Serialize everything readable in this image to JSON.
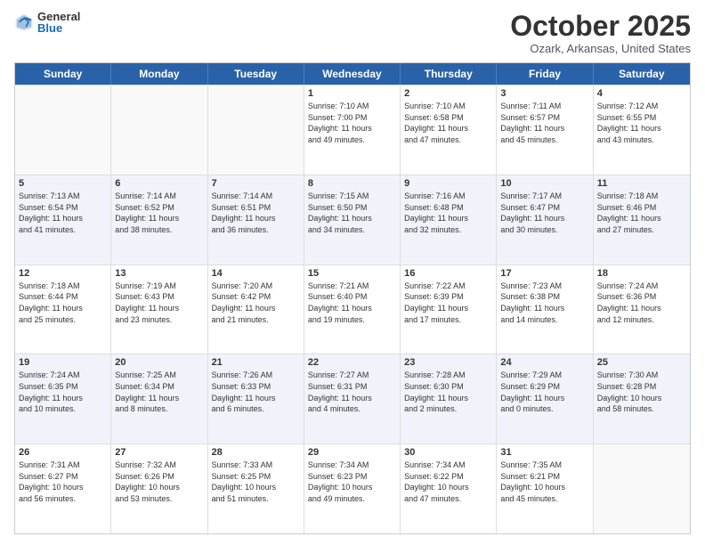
{
  "logo": {
    "general": "General",
    "blue": "Blue"
  },
  "title": "October 2025",
  "subtitle": "Ozark, Arkansas, United States",
  "days_of_week": [
    "Sunday",
    "Monday",
    "Tuesday",
    "Wednesday",
    "Thursday",
    "Friday",
    "Saturday"
  ],
  "rows": [
    [
      {
        "day": "",
        "empty": true
      },
      {
        "day": "",
        "empty": true
      },
      {
        "day": "",
        "empty": true
      },
      {
        "day": "1",
        "lines": [
          "Sunrise: 7:10 AM",
          "Sunset: 7:00 PM",
          "Daylight: 11 hours",
          "and 49 minutes."
        ]
      },
      {
        "day": "2",
        "lines": [
          "Sunrise: 7:10 AM",
          "Sunset: 6:58 PM",
          "Daylight: 11 hours",
          "and 47 minutes."
        ]
      },
      {
        "day": "3",
        "lines": [
          "Sunrise: 7:11 AM",
          "Sunset: 6:57 PM",
          "Daylight: 11 hours",
          "and 45 minutes."
        ]
      },
      {
        "day": "4",
        "lines": [
          "Sunrise: 7:12 AM",
          "Sunset: 6:55 PM",
          "Daylight: 11 hours",
          "and 43 minutes."
        ]
      }
    ],
    [
      {
        "day": "5",
        "lines": [
          "Sunrise: 7:13 AM",
          "Sunset: 6:54 PM",
          "Daylight: 11 hours",
          "and 41 minutes."
        ]
      },
      {
        "day": "6",
        "lines": [
          "Sunrise: 7:14 AM",
          "Sunset: 6:52 PM",
          "Daylight: 11 hours",
          "and 38 minutes."
        ]
      },
      {
        "day": "7",
        "lines": [
          "Sunrise: 7:14 AM",
          "Sunset: 6:51 PM",
          "Daylight: 11 hours",
          "and 36 minutes."
        ]
      },
      {
        "day": "8",
        "lines": [
          "Sunrise: 7:15 AM",
          "Sunset: 6:50 PM",
          "Daylight: 11 hours",
          "and 34 minutes."
        ]
      },
      {
        "day": "9",
        "lines": [
          "Sunrise: 7:16 AM",
          "Sunset: 6:48 PM",
          "Daylight: 11 hours",
          "and 32 minutes."
        ]
      },
      {
        "day": "10",
        "lines": [
          "Sunrise: 7:17 AM",
          "Sunset: 6:47 PM",
          "Daylight: 11 hours",
          "and 30 minutes."
        ]
      },
      {
        "day": "11",
        "lines": [
          "Sunrise: 7:18 AM",
          "Sunset: 6:46 PM",
          "Daylight: 11 hours",
          "and 27 minutes."
        ]
      }
    ],
    [
      {
        "day": "12",
        "lines": [
          "Sunrise: 7:18 AM",
          "Sunset: 6:44 PM",
          "Daylight: 11 hours",
          "and 25 minutes."
        ]
      },
      {
        "day": "13",
        "lines": [
          "Sunrise: 7:19 AM",
          "Sunset: 6:43 PM",
          "Daylight: 11 hours",
          "and 23 minutes."
        ]
      },
      {
        "day": "14",
        "lines": [
          "Sunrise: 7:20 AM",
          "Sunset: 6:42 PM",
          "Daylight: 11 hours",
          "and 21 minutes."
        ]
      },
      {
        "day": "15",
        "lines": [
          "Sunrise: 7:21 AM",
          "Sunset: 6:40 PM",
          "Daylight: 11 hours",
          "and 19 minutes."
        ]
      },
      {
        "day": "16",
        "lines": [
          "Sunrise: 7:22 AM",
          "Sunset: 6:39 PM",
          "Daylight: 11 hours",
          "and 17 minutes."
        ]
      },
      {
        "day": "17",
        "lines": [
          "Sunrise: 7:23 AM",
          "Sunset: 6:38 PM",
          "Daylight: 11 hours",
          "and 14 minutes."
        ]
      },
      {
        "day": "18",
        "lines": [
          "Sunrise: 7:24 AM",
          "Sunset: 6:36 PM",
          "Daylight: 11 hours",
          "and 12 minutes."
        ]
      }
    ],
    [
      {
        "day": "19",
        "lines": [
          "Sunrise: 7:24 AM",
          "Sunset: 6:35 PM",
          "Daylight: 11 hours",
          "and 10 minutes."
        ]
      },
      {
        "day": "20",
        "lines": [
          "Sunrise: 7:25 AM",
          "Sunset: 6:34 PM",
          "Daylight: 11 hours",
          "and 8 minutes."
        ]
      },
      {
        "day": "21",
        "lines": [
          "Sunrise: 7:26 AM",
          "Sunset: 6:33 PM",
          "Daylight: 11 hours",
          "and 6 minutes."
        ]
      },
      {
        "day": "22",
        "lines": [
          "Sunrise: 7:27 AM",
          "Sunset: 6:31 PM",
          "Daylight: 11 hours",
          "and 4 minutes."
        ]
      },
      {
        "day": "23",
        "lines": [
          "Sunrise: 7:28 AM",
          "Sunset: 6:30 PM",
          "Daylight: 11 hours",
          "and 2 minutes."
        ]
      },
      {
        "day": "24",
        "lines": [
          "Sunrise: 7:29 AM",
          "Sunset: 6:29 PM",
          "Daylight: 11 hours",
          "and 0 minutes."
        ]
      },
      {
        "day": "25",
        "lines": [
          "Sunrise: 7:30 AM",
          "Sunset: 6:28 PM",
          "Daylight: 10 hours",
          "and 58 minutes."
        ]
      }
    ],
    [
      {
        "day": "26",
        "lines": [
          "Sunrise: 7:31 AM",
          "Sunset: 6:27 PM",
          "Daylight: 10 hours",
          "and 56 minutes."
        ]
      },
      {
        "day": "27",
        "lines": [
          "Sunrise: 7:32 AM",
          "Sunset: 6:26 PM",
          "Daylight: 10 hours",
          "and 53 minutes."
        ]
      },
      {
        "day": "28",
        "lines": [
          "Sunrise: 7:33 AM",
          "Sunset: 6:25 PM",
          "Daylight: 10 hours",
          "and 51 minutes."
        ]
      },
      {
        "day": "29",
        "lines": [
          "Sunrise: 7:34 AM",
          "Sunset: 6:23 PM",
          "Daylight: 10 hours",
          "and 49 minutes."
        ]
      },
      {
        "day": "30",
        "lines": [
          "Sunrise: 7:34 AM",
          "Sunset: 6:22 PM",
          "Daylight: 10 hours",
          "and 47 minutes."
        ]
      },
      {
        "day": "31",
        "lines": [
          "Sunrise: 7:35 AM",
          "Sunset: 6:21 PM",
          "Daylight: 10 hours",
          "and 45 minutes."
        ]
      },
      {
        "day": "",
        "empty": true
      }
    ]
  ]
}
